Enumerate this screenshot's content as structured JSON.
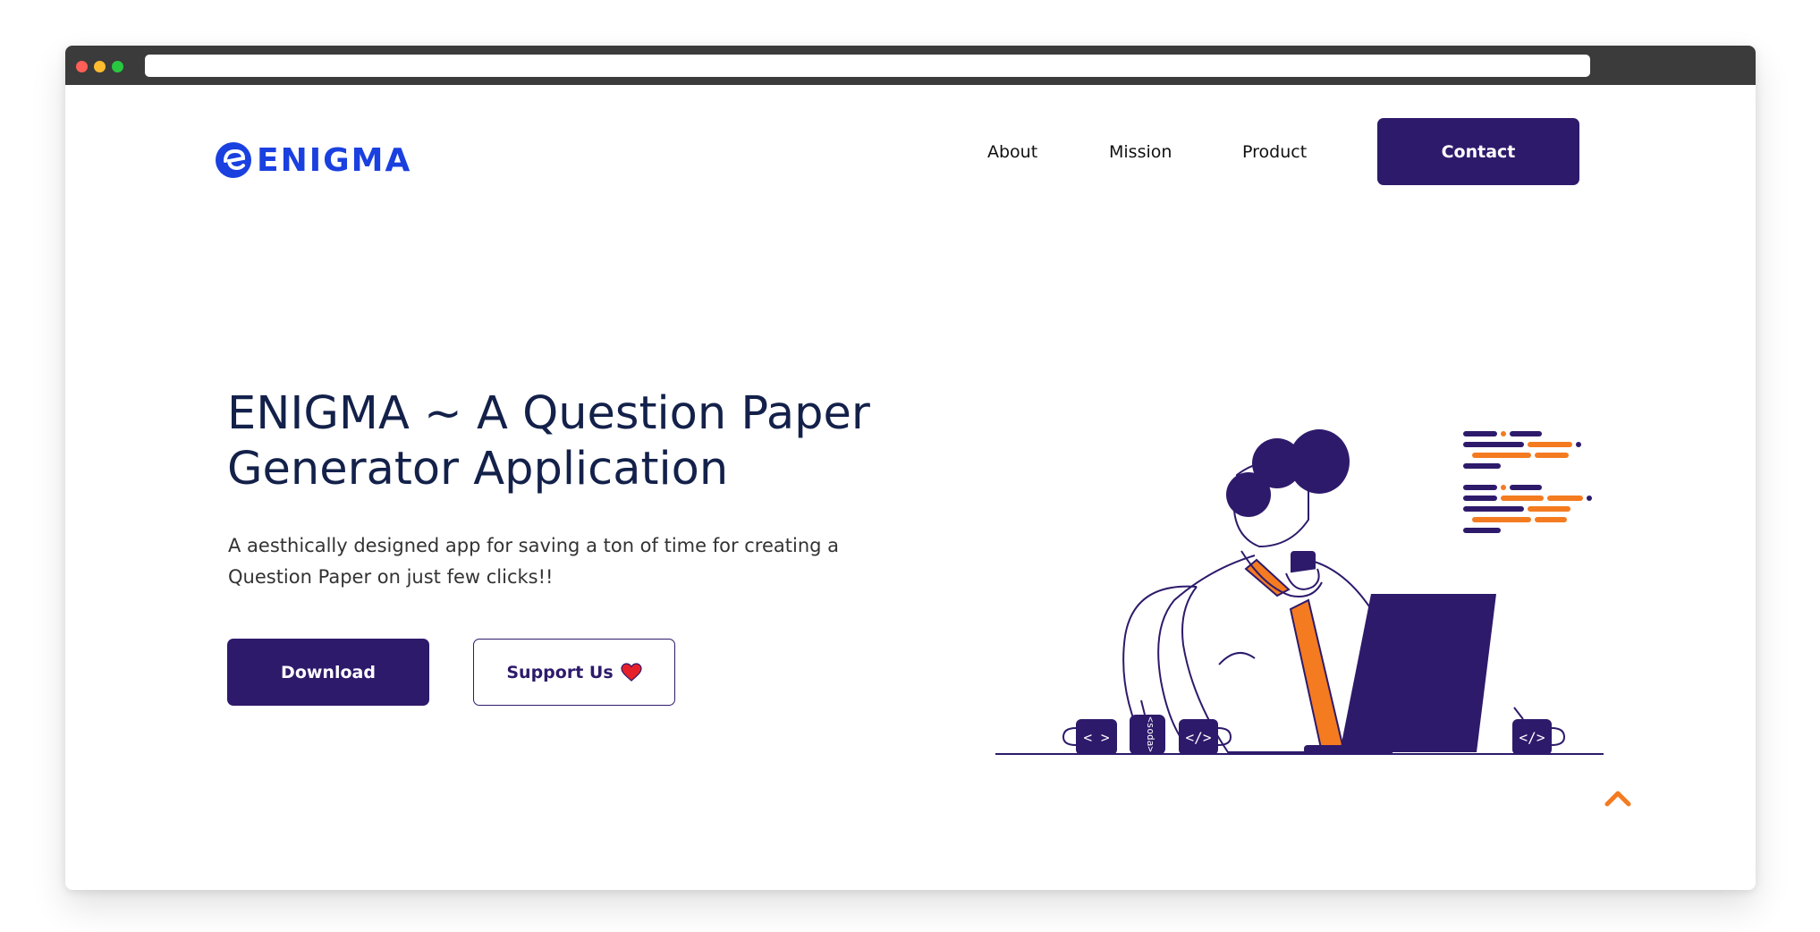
{
  "brand": {
    "name": "ENIGMA",
    "color": "#1a40e0"
  },
  "nav": {
    "items": [
      {
        "label": "About"
      },
      {
        "label": "Mission"
      },
      {
        "label": "Product"
      }
    ],
    "contact_label": "Contact"
  },
  "hero": {
    "title": "ENIGMA ~ A Question Paper Generator Application",
    "description": "A aesthically designed app for saving a ton of time for creating a Question Paper on just few clicks!!",
    "download_label": "Download",
    "support_label": "Support Us",
    "support_icon": "heart-icon"
  },
  "illustration": {
    "mug_labels": [
      "< >",
      "</>",
      "</>"
    ],
    "can_label": "<soda>"
  },
  "colors": {
    "primary": "#2e1a6b",
    "accent": "#f47b20",
    "title": "#13214a",
    "heart": "#e6202a"
  },
  "icons": {
    "scroll_top": "chevron-up-icon"
  }
}
